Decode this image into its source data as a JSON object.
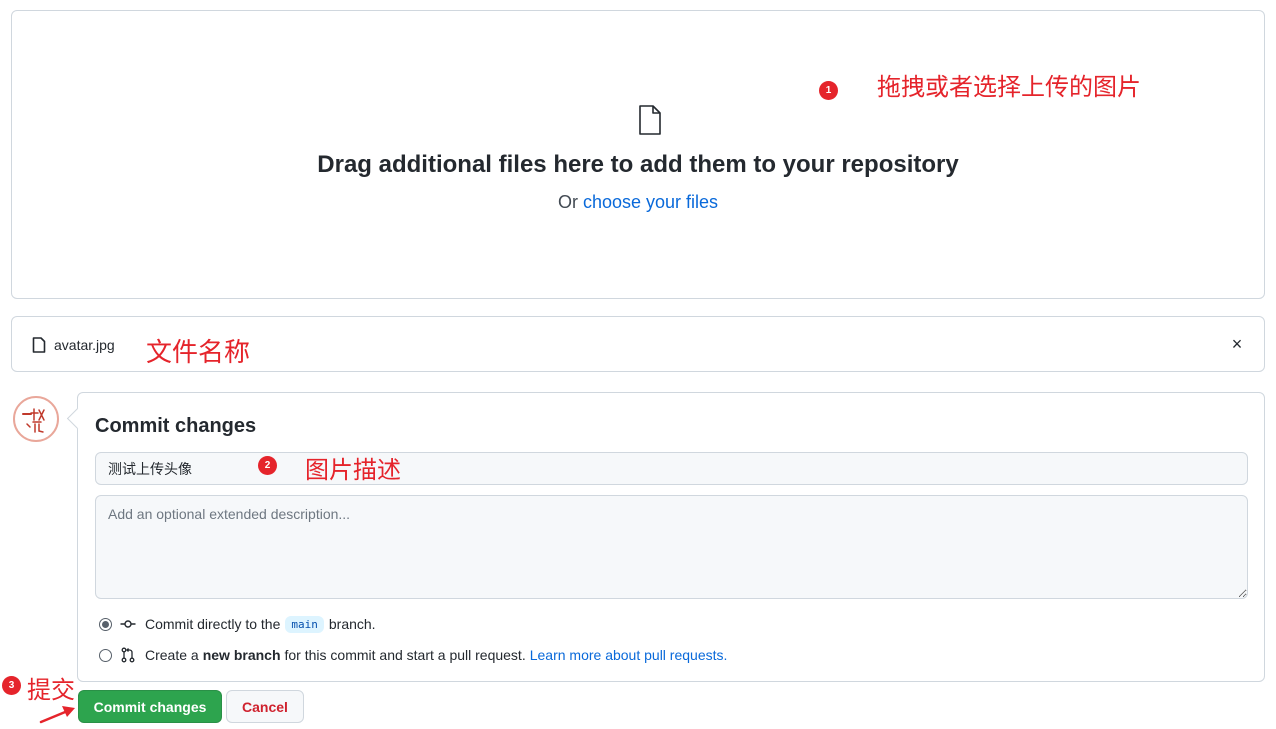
{
  "dropzone": {
    "title": "Drag additional files here to add them to your repository",
    "or_text": "Or",
    "choose_link": "choose your files"
  },
  "annotations": {
    "a1_num": "1",
    "a1_text": "拖拽或者选择上传的图片",
    "a_filename": "文件名称",
    "a2_num": "2",
    "a2_text": "图片描述",
    "a3_num": "3",
    "a3_text": "提交"
  },
  "file": {
    "name": "avatar.jpg",
    "remove": "×"
  },
  "commit": {
    "title": "Commit changes",
    "summary_value": "测试上传头像",
    "description_placeholder": "Add an optional extended description...",
    "option_direct": {
      "prefix": "Commit directly to the",
      "branch": "main",
      "suffix": "branch."
    },
    "option_new": {
      "prefix": "Create a",
      "bold": "new branch",
      "suffix": "for this commit and start a pull request.",
      "link": "Learn more about pull requests."
    },
    "commit_button": "Commit changes",
    "cancel_button": "Cancel"
  },
  "colors": {
    "annotation_red": "#e5242b",
    "primary_green": "#2da44e",
    "link_blue": "#0969da",
    "cancel_red": "#cf222e"
  }
}
